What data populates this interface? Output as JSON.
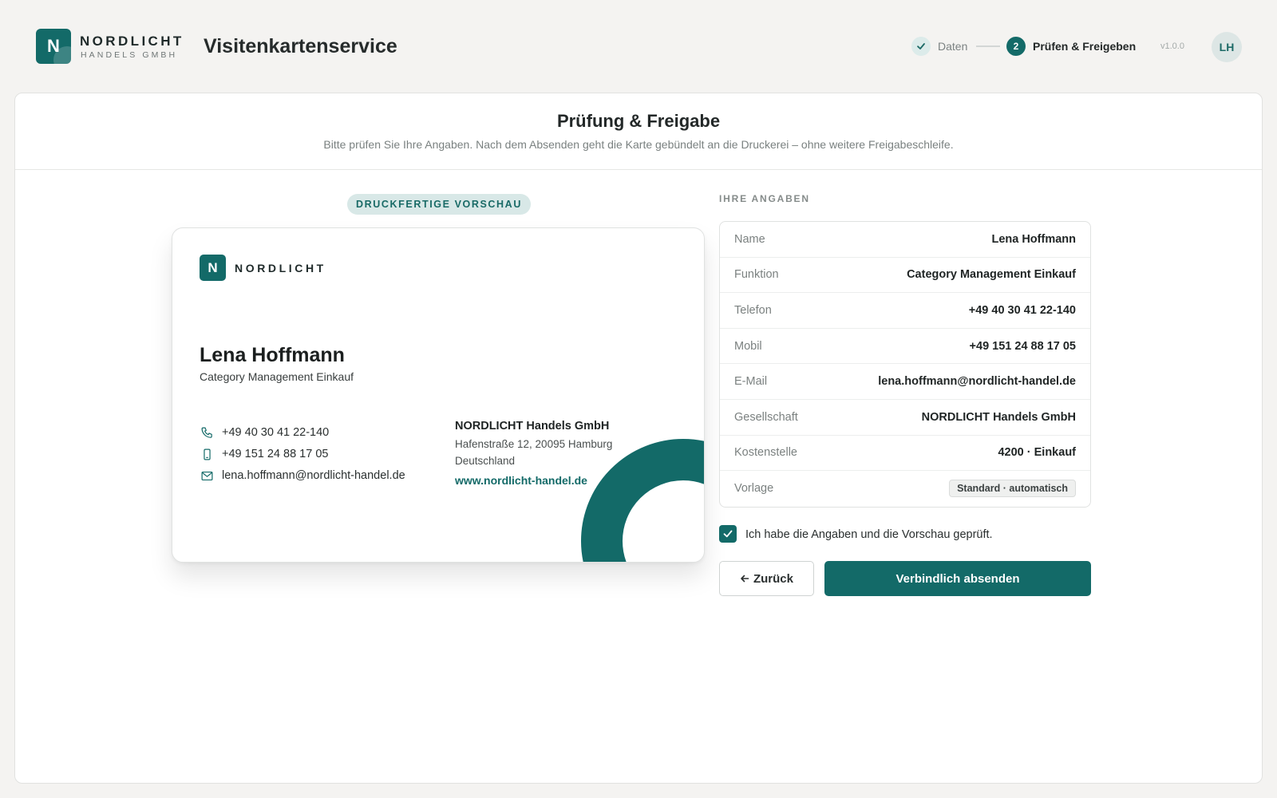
{
  "header": {
    "logo_letter": "N",
    "brand_name": "NORDLICHT",
    "brand_sub": "HANDELS GMBH",
    "app_title": "Visitenkartenservice",
    "steps": [
      {
        "label": "Daten",
        "state": "done"
      },
      {
        "number": "2",
        "label": "Prüfen & Freigeben",
        "state": "active"
      }
    ],
    "version": "v1.0.0",
    "avatar_initials": "LH"
  },
  "main": {
    "title": "Prüfung & Freigabe",
    "subtitle": "Bitte prüfen Sie Ihre Angaben. Nach dem Absenden geht die Karte gebündelt an die Druckerei – ohne weitere Freigabeschleife."
  },
  "preview": {
    "pill": "DRUCKFERTIGE VORSCHAU",
    "card": {
      "logo_letter": "N",
      "brand": "NORDLICHT",
      "name": "Lena Hoffmann",
      "role": "Category Management Einkauf",
      "phone": "+49 40 30 41 22-140",
      "mobile": "+49 151 24 88 17 05",
      "email": "lena.hoffmann@nordlicht-handel.de",
      "company": "NORDLICHT Handels GmbH",
      "address_line1": "Hafenstraße 12, 20095 Hamburg",
      "address_line2": "Deutschland",
      "website": "www.nordlicht-handel.de"
    }
  },
  "details": {
    "section_label": "IHRE ANGABEN",
    "rows": [
      {
        "key": "Name",
        "value": "Lena Hoffmann"
      },
      {
        "key": "Funktion",
        "value": "Category Management Einkauf"
      },
      {
        "key": "Telefon",
        "value": "+49 40 30 41 22-140"
      },
      {
        "key": "Mobil",
        "value": "+49 151 24 88 17 05"
      },
      {
        "key": "E-Mail",
        "value": "lena.hoffmann@nordlicht-handel.de"
      },
      {
        "key": "Gesellschaft",
        "value": "NORDLICHT Handels GmbH"
      },
      {
        "key": "Kostenstelle",
        "value": "4200 · Einkauf"
      },
      {
        "key": "Vorlage",
        "value": "Standard · automatisch"
      }
    ],
    "confirm_label": "Ich habe die Angaben und die Vorschau geprüft.",
    "confirm_checked": true,
    "back_label": "Zurück",
    "submit_label": "Verbindlich absenden"
  },
  "colors": {
    "accent": "#136a68",
    "accent_light": "#d8e8e7",
    "background": "#f4f3f1"
  }
}
